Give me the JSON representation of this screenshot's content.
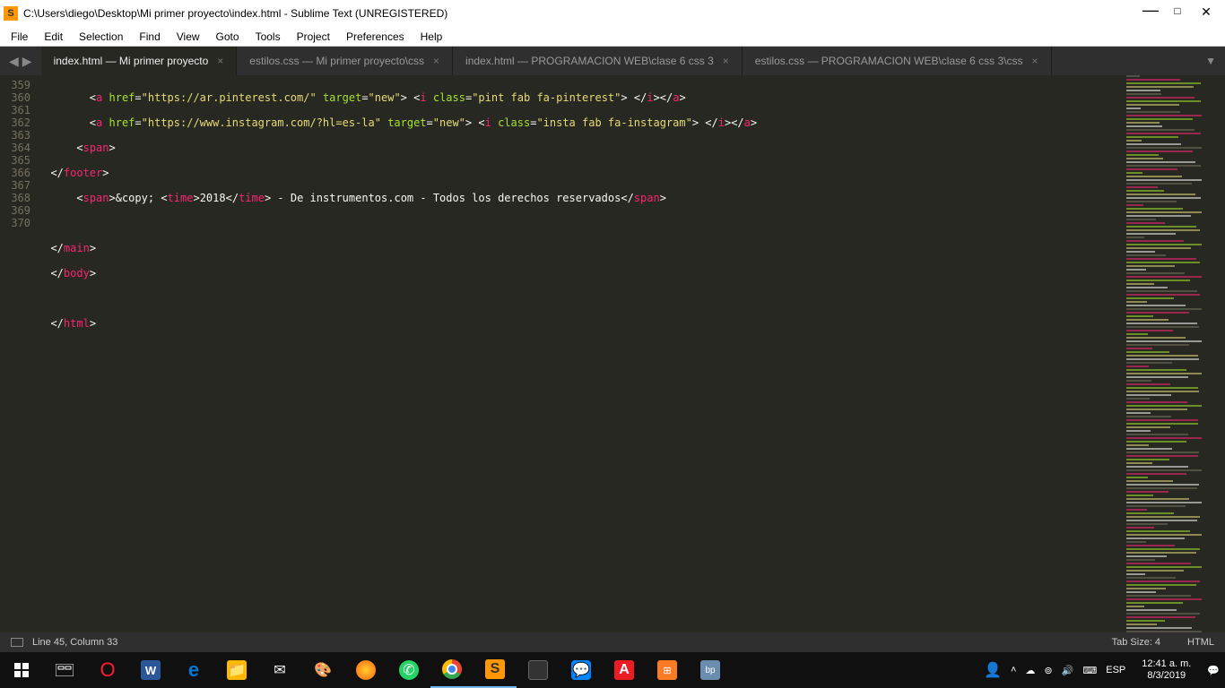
{
  "window": {
    "title": "C:\\Users\\diego\\Desktop\\Mi primer proyecto\\index.html - Sublime Text (UNREGISTERED)"
  },
  "menu": {
    "file": "File",
    "edit": "Edit",
    "selection": "Selection",
    "find": "Find",
    "view": "View",
    "goto": "Goto",
    "tools": "Tools",
    "project": "Project",
    "preferences": "Preferences",
    "help": "Help"
  },
  "tabs": {
    "t1": "index.html — Mi primer proyecto",
    "t2": "estilos.css — Mi primer proyecto\\css",
    "t3": "index.html — PROGRAMACION  WEB\\clase 6 css 3",
    "t4": "estilos.css — PROGRAMACION  WEB\\clase 6 css 3\\css"
  },
  "lines": {
    "n359": "359",
    "n360": "360",
    "n361": "361",
    "n362": "362",
    "n363": "363",
    "n364": "364",
    "n365": "365",
    "n366": "366",
    "n367": "367",
    "n368": "368",
    "n369": "369",
    "n370": "370"
  },
  "code": {
    "l359": {
      "indent": "        ",
      "a_open": "a",
      "href_attr": "href",
      "href_val": "\"https://ar.pinterest.com/\"",
      "target_attr": "target",
      "target_val": "\"new\"",
      "i_open": "i",
      "class_attr": "class",
      "class_val": "\"pint fab fa-pinterest\"",
      "i_close": "i",
      "a_close": "a"
    },
    "l360": {
      "indent": "        ",
      "a_open": "a",
      "href_attr": "href",
      "href_val": "\"https://www.instagram.com/?hl=es-la\"",
      "target_attr": "target",
      "target_val": "\"new\"",
      "i_open": "i",
      "class_attr": "class",
      "class_val": "\"insta fab fa-instagram\"",
      "i_close": "i",
      "a_close": "a"
    },
    "l361": {
      "indent": "      ",
      "tag": "span"
    },
    "l362": {
      "indent": "  ",
      "tag": "footer"
    },
    "l363": {
      "indent": "      ",
      "span": "span",
      "copy": "&copy;",
      "sep1": " ",
      "time": "time",
      "year": "2018",
      "rest": " - De instrumentos.com - Todos los derechos reservados"
    },
    "l365": {
      "indent": "  ",
      "tag": "main"
    },
    "l366": {
      "indent": "  ",
      "tag": "body"
    },
    "l368": {
      "indent": "  ",
      "tag": "html"
    }
  },
  "status": {
    "position": "Line 45, Column 33",
    "tabsize": "Tab Size: 4",
    "syntax": "HTML"
  },
  "taskbar": {
    "lang": "ESP",
    "time": "12:41 a. m.",
    "date": "8/3/2019"
  }
}
